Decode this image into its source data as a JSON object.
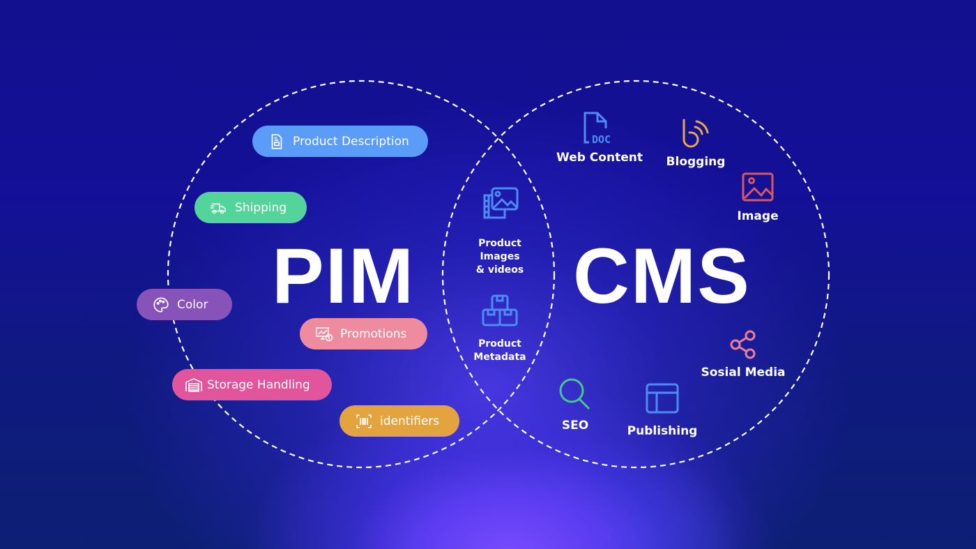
{
  "left_circle": {
    "title": "PIM",
    "items": [
      {
        "label": "Product Description",
        "icon": "document-icon",
        "color": "#5b9cf8"
      },
      {
        "label": "Shipping",
        "icon": "truck-icon",
        "color": "#52d49a"
      },
      {
        "label": "Color",
        "icon": "palette-icon",
        "color": "#8753b8"
      },
      {
        "label": "Promotions",
        "icon": "monitor-dollar-icon",
        "color": "#ee8b9e"
      },
      {
        "label": "Storage Handling",
        "icon": "warehouse-icon",
        "color": "#e2549b"
      },
      {
        "label": "identifiers",
        "icon": "barcode-icon",
        "color": "#e3a43f"
      }
    ]
  },
  "overlap": {
    "items": [
      {
        "label": "Product\nImages\n& videos",
        "icon": "images-videos-icon",
        "color": "#4e8cf5"
      },
      {
        "label": "Product\nMetadata",
        "icon": "boxes-icon",
        "color": "#4e8cf5"
      }
    ]
  },
  "right_circle": {
    "title": "CMS",
    "items": [
      {
        "label": "Web Content",
        "icon": "doc-file-icon",
        "color": "#4e8cf5"
      },
      {
        "label": "Blogging",
        "icon": "blog-icon",
        "color": "#e8a84a"
      },
      {
        "label": "Image",
        "icon": "image-icon",
        "color": "#d9575d"
      },
      {
        "label": "Sosial Media",
        "icon": "share-icon",
        "color": "#ee7f93"
      },
      {
        "label": "SEO",
        "icon": "search-icon",
        "color": "#46c98c"
      },
      {
        "label": "Publishing",
        "icon": "layout-icon",
        "color": "#4e8cf5"
      }
    ]
  }
}
